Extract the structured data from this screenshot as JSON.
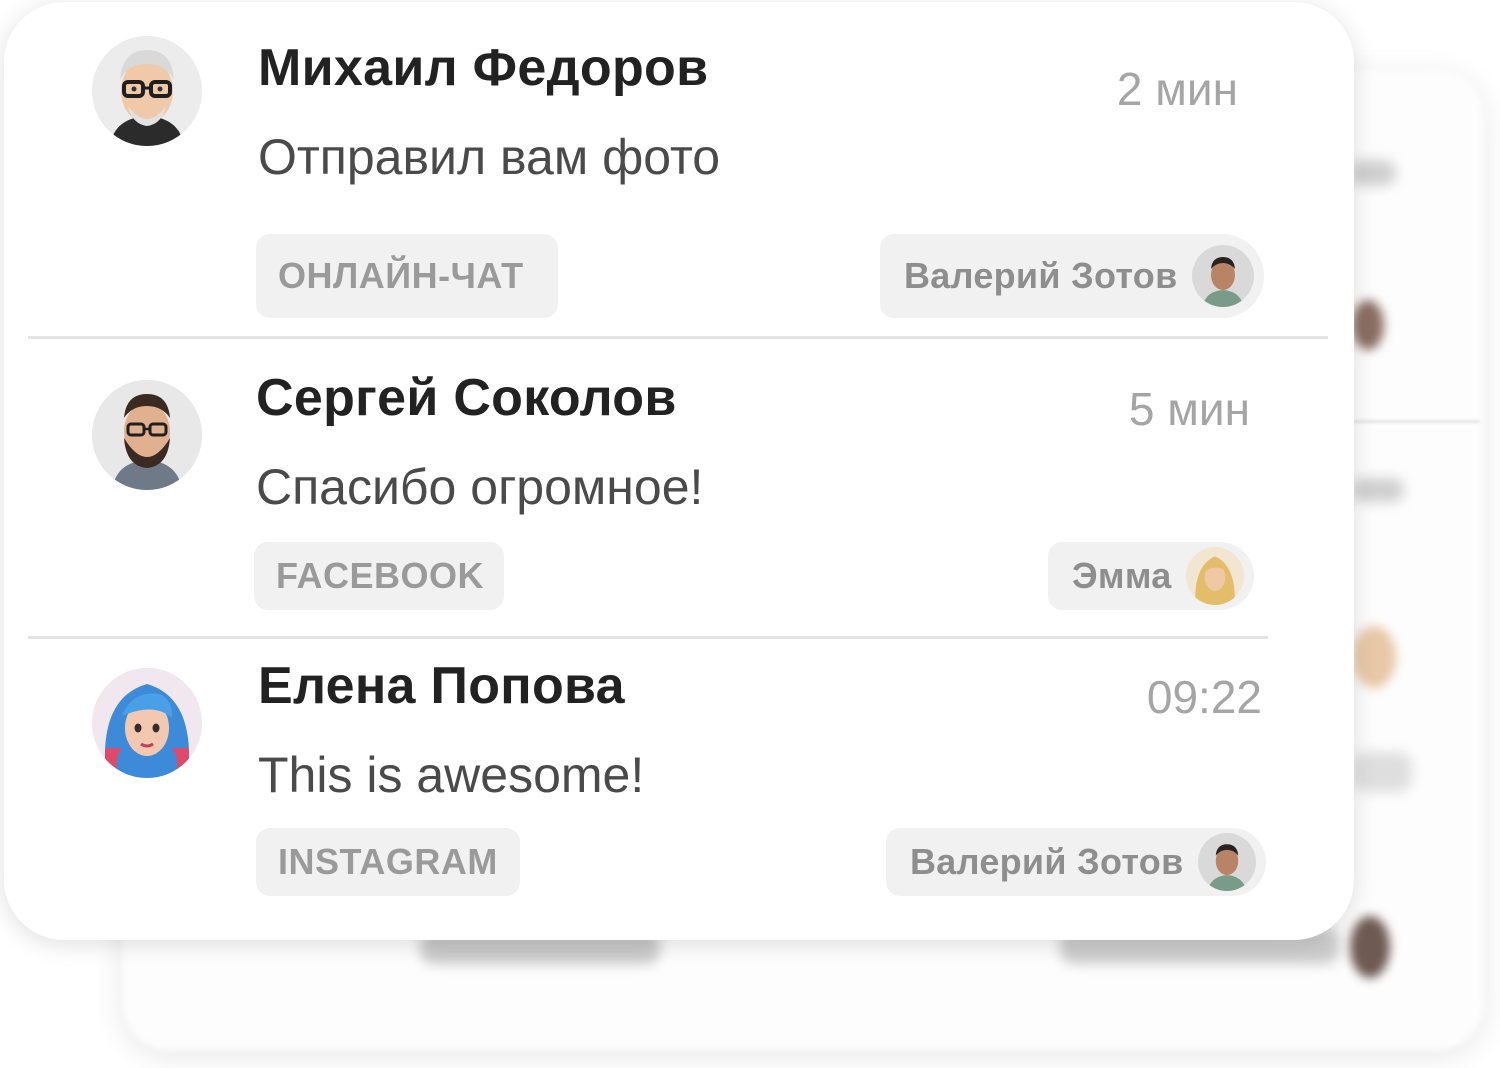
{
  "conversations": [
    {
      "contact_name": "Михаил Федоров",
      "time": "2 мин",
      "last_message": "Отправил вам фото",
      "channel": "ОНЛАЙН-ЧАТ",
      "assignee": "Валерий Зотов"
    },
    {
      "contact_name": "Сергей Соколов",
      "time": "5 мин",
      "last_message": "Спасибо огромное!",
      "channel": "FACEBOOK",
      "assignee": "Эмма"
    },
    {
      "contact_name": "Елена Попова",
      "time": "09:22",
      "last_message": "This is awesome!",
      "channel": "INSTAGRAM",
      "assignee": "Валерий Зотов"
    }
  ],
  "colors": {
    "card_bg": "#ffffff",
    "tag_bg": "#f1f1f1",
    "name_text": "#222222",
    "muted_text": "#a5a5a5"
  }
}
